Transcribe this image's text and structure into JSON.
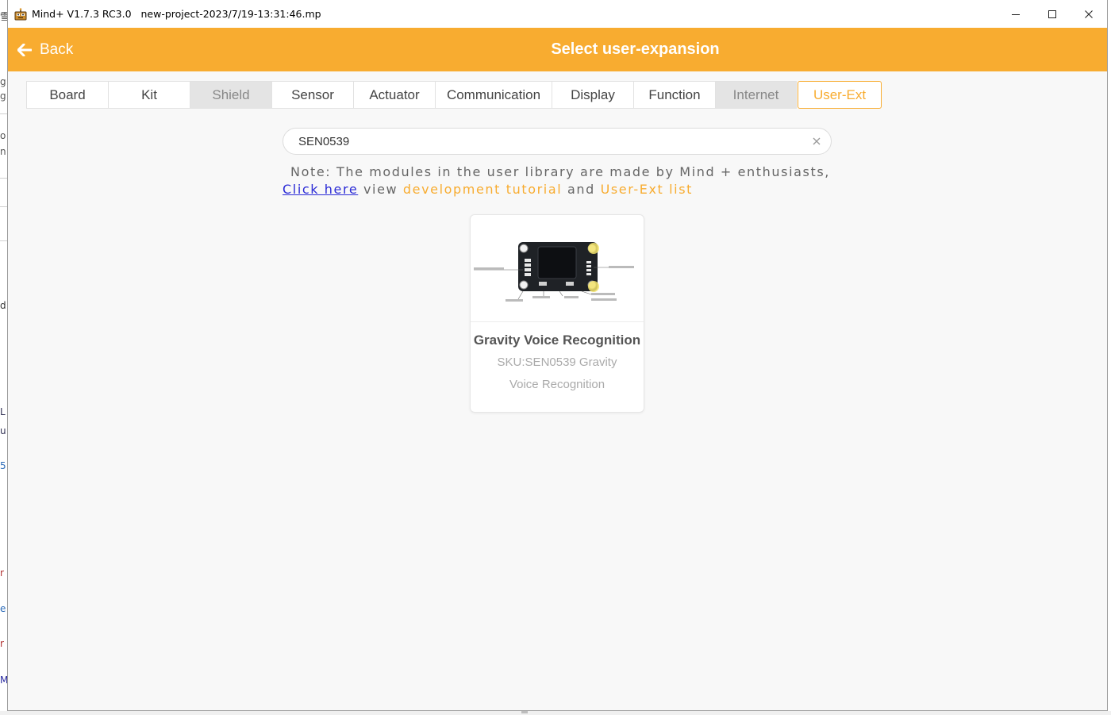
{
  "window": {
    "app_name": "Mind+ V1.7.3 RC3.0",
    "file_name": "new-project-2023/7/19-13:31:46.mp"
  },
  "header": {
    "back_label": "Back",
    "title": "Select user-expansion",
    "accent_color": "#f8ac30"
  },
  "tabs": [
    {
      "label": "Board",
      "state": "normal"
    },
    {
      "label": "Kit",
      "state": "normal"
    },
    {
      "label": "Shield",
      "state": "disabled"
    },
    {
      "label": "Sensor",
      "state": "normal"
    },
    {
      "label": "Actuator",
      "state": "normal"
    },
    {
      "label": "Communication",
      "state": "normal"
    },
    {
      "label": "Display",
      "state": "normal"
    },
    {
      "label": "Function",
      "state": "normal"
    },
    {
      "label": "Internet",
      "state": "disabled"
    },
    {
      "label": "User-Ext",
      "state": "active"
    }
  ],
  "search": {
    "value": "SEN0539"
  },
  "note": {
    "line1": "Note: The modules in the user library are made by Mind + enthusiasts,",
    "click_here": "Click here",
    "view": "view",
    "dev_tutorial": "development tutorial",
    "and": "and",
    "ext_list": "User-Ext list"
  },
  "results": [
    {
      "name": "Gravity Voice Recognition",
      "description": "SKU:SEN0539 Gravity Voice Recognition"
    }
  ]
}
